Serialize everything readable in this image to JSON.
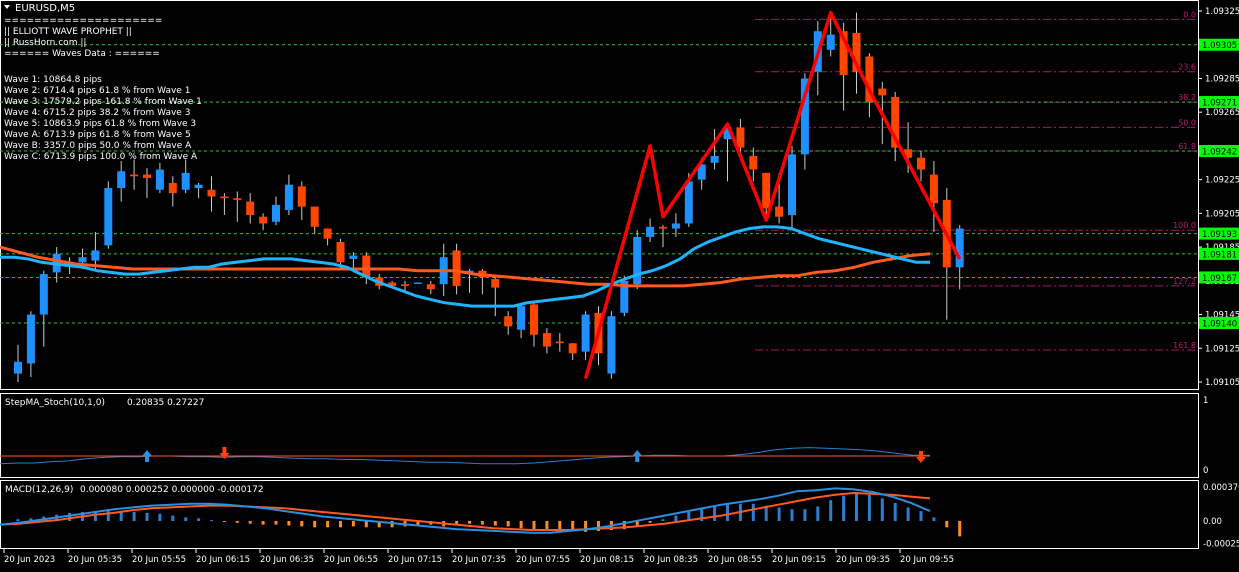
{
  "colors": {
    "background": "#000000",
    "frame": "#ffffff",
    "bull_candle": "#1e90ff",
    "bear_candle": "#ff4500",
    "wick": "#cccccc",
    "ma_fast": "#1fb4ff",
    "ma_slow": "#ff5a1f",
    "zigzag": "#ff0000",
    "green_level": "#3cbe3c",
    "green_tag_bg": "#00ff00",
    "fib_line": "#b01070",
    "fib_text": "#c01a7a",
    "text": "#ffffff"
  },
  "chart_header": {
    "symbol_label": "EURUSD,M5",
    "menu_icon": "triangle-down-icon"
  },
  "info_panel": {
    "lines": [
      "=====================",
      "||    ELLIOTT WAVE PROPHET   ||",
      "||          RussHorn.com          ||",
      "====== Waves Data : ======"
    ],
    "waves": [
      "Wave 1: 10864.8 pips",
      "Wave 2: 6714.4 pips 61.8 % from Wave 1",
      "Wave 3: 17579.2 pips 161.8 % from Wave 1",
      "Wave 4: 6715.2 pips 38.2 % from Wave 3",
      "Wave 5: 10863.9 pips 61.8 % from Wave 3",
      "Wave A: 6713.9 pips 61.8 % from Wave 5",
      "Wave B: 3357.0 pips 50.0 % from Wave A",
      "Wave C: 6713.9 pips 100.0 % from Wave A"
    ]
  },
  "chart_data": [
    {
      "type": "candlestick",
      "title": "EURUSD,M5",
      "ylim": [
        1.09095,
        1.09335
      ],
      "price_ticks": [
        "1.09325",
        "1.09285",
        "1.09265",
        "1.09225",
        "1.09205",
        "1.09185",
        "1.09165",
        "1.09145",
        "1.09125",
        "1.09105"
      ],
      "green_levels": [
        "1.09305",
        "1.09271",
        "1.09242",
        "1.09193",
        "1.09181",
        "1.09167",
        "1.09140"
      ],
      "fib_levels": [
        {
          "label": "0.0",
          "value": 1.0932
        },
        {
          "label": "23.6",
          "value": 1.09289
        },
        {
          "label": "38.2",
          "value": 1.09271
        },
        {
          "label": "50.0",
          "value": 1.09256
        },
        {
          "label": "61.8",
          "value": 1.09242
        },
        {
          "label": "100.0",
          "value": 1.09195
        },
        {
          "label": "127.2",
          "value": 1.09162
        },
        {
          "label": "161.8",
          "value": 1.09124
        }
      ],
      "candles": [
        [
          1.0911,
          1.09117,
          1.09105,
          1.09127
        ],
        [
          1.09116,
          1.09145,
          1.09108,
          1.09147
        ],
        [
          1.09145,
          1.09169,
          1.09126,
          1.09171
        ],
        [
          1.0917,
          1.09181,
          1.09164,
          1.09185
        ],
        [
          1.09176,
          1.09176,
          1.09169,
          1.09179
        ],
        [
          1.09176,
          1.09179,
          1.09172,
          1.09184
        ],
        [
          1.09177,
          1.09183,
          1.09172,
          1.09194
        ],
        [
          1.09186,
          1.0922,
          1.09184,
          1.09224
        ],
        [
          1.0922,
          1.0923,
          1.09212,
          1.09236
        ],
        [
          1.09228,
          1.09227,
          1.09219,
          1.09237
        ],
        [
          1.09228,
          1.09226,
          1.09214,
          1.09232
        ],
        [
          1.09219,
          1.09231,
          1.09217,
          1.09235
        ],
        [
          1.09223,
          1.09217,
          1.09209,
          1.09227
        ],
        [
          1.09219,
          1.09229,
          1.09217,
          1.09237
        ],
        [
          1.0922,
          1.09222,
          1.09214,
          1.09223
        ],
        [
          1.09219,
          1.09215,
          1.09206,
          1.09227
        ],
        [
          1.09215,
          1.09214,
          1.09204,
          1.09217
        ],
        [
          1.09214,
          1.09213,
          1.092,
          1.09218
        ],
        [
          1.09212,
          1.09204,
          1.09199,
          1.09217
        ],
        [
          1.09203,
          1.09199,
          1.09195,
          1.09205
        ],
        [
          1.092,
          1.0921,
          1.09198,
          1.09215
        ],
        [
          1.09207,
          1.09222,
          1.09204,
          1.09228
        ],
        [
          1.09221,
          1.09209,
          1.09201,
          1.09224
        ],
        [
          1.09209,
          1.09197,
          1.09193,
          1.09209
        ],
        [
          1.09196,
          1.0919,
          1.09186,
          1.09196
        ],
        [
          1.09188,
          1.09176,
          1.09172,
          1.0919
        ],
        [
          1.09178,
          1.0918,
          1.0917,
          1.09182
        ],
        [
          1.0918,
          1.09167,
          1.09163,
          1.09182
        ],
        [
          1.09167,
          1.09162,
          1.0916,
          1.09169
        ],
        [
          1.09164,
          1.09162,
          1.09162,
          1.09165
        ],
        [
          1.09163,
          1.09162,
          1.09159,
          1.09165
        ],
        [
          1.09164,
          1.09164,
          1.09164,
          1.09164
        ],
        [
          1.09163,
          1.0916,
          1.09157,
          1.09165
        ],
        [
          1.09163,
          1.09179,
          1.09156,
          1.09187
        ],
        [
          1.09183,
          1.09162,
          1.09157,
          1.09187
        ],
        [
          1.09169,
          1.09171,
          1.09158,
          1.09172
        ],
        [
          1.09171,
          1.09167,
          1.09157,
          1.09172
        ],
        [
          1.09166,
          1.09161,
          1.09144,
          1.09167
        ],
        [
          1.09144,
          1.09138,
          1.09133,
          1.09147
        ],
        [
          1.09136,
          1.0915,
          1.09131,
          1.09152
        ],
        [
          1.09151,
          1.09133,
          1.09126,
          1.09153
        ],
        [
          1.09134,
          1.09126,
          1.09122,
          1.09137
        ],
        [
          1.09129,
          1.09128,
          1.09123,
          1.09134
        ],
        [
          1.09128,
          1.09122,
          1.09118,
          1.09128
        ],
        [
          1.09123,
          1.09145,
          1.09118,
          1.09147
        ],
        [
          1.09146,
          1.09122,
          1.09115,
          1.0915
        ],
        [
          1.0911,
          1.09144,
          1.09107,
          1.09147
        ],
        [
          1.09146,
          1.09165,
          1.09144,
          1.09168
        ],
        [
          1.09163,
          1.09191,
          1.0916,
          1.09195
        ],
        [
          1.09191,
          1.09197,
          1.09188,
          1.09202
        ],
        [
          1.09197,
          1.09196,
          1.09185,
          1.09198
        ],
        [
          1.09196,
          1.09199,
          1.09191,
          1.09205
        ],
        [
          1.09199,
          1.09224,
          1.09197,
          1.09229
        ],
        [
          1.09225,
          1.09234,
          1.09219,
          1.09238
        ],
        [
          1.09235,
          1.09239,
          1.09231,
          1.09255
        ],
        [
          1.09249,
          1.09256,
          1.09224,
          1.09258
        ],
        [
          1.09256,
          1.09244,
          1.09237,
          1.09261
        ],
        [
          1.09239,
          1.09231,
          1.09224,
          1.09244
        ],
        [
          1.09229,
          1.09208,
          1.09201,
          1.09229
        ],
        [
          1.09209,
          1.09203,
          1.09199,
          1.09229
        ],
        [
          1.09204,
          1.0924,
          1.09196,
          1.09245
        ],
        [
          1.0924,
          1.09285,
          1.09231,
          1.09288
        ],
        [
          1.09289,
          1.09313,
          1.09275,
          1.09319
        ],
        [
          1.09302,
          1.09311,
          1.09298,
          1.09322
        ],
        [
          1.09313,
          1.09287,
          1.09266,
          1.09318
        ],
        [
          1.09312,
          1.09289,
          1.09276,
          1.09324
        ],
        [
          1.09298,
          1.09271,
          1.09262,
          1.093
        ],
        [
          1.09279,
          1.09275,
          1.09246,
          1.09283
        ],
        [
          1.09274,
          1.09244,
          1.09236,
          1.09277
        ],
        [
          1.09243,
          1.09238,
          1.09229,
          1.09259
        ],
        [
          1.09238,
          1.09231,
          1.09224,
          1.09242
        ],
        [
          1.09228,
          1.09211,
          1.09194,
          1.09236
        ],
        [
          1.09213,
          1.09173,
          1.09142,
          1.0922
        ],
        [
          1.09173,
          1.09196,
          1.0916,
          1.09198
        ]
      ],
      "ma_fast": [
        1.09179,
        1.09179,
        1.09178,
        1.09176,
        1.09175,
        1.09174,
        1.09173,
        1.09171,
        1.0917,
        1.09169,
        1.09169,
        1.0917,
        1.09171,
        1.09172,
        1.09173,
        1.09173,
        1.09175,
        1.09176,
        1.09177,
        1.09178,
        1.09178,
        1.09178,
        1.09177,
        1.09176,
        1.09175,
        1.09173,
        1.09169,
        1.09165,
        1.09162,
        1.09159,
        1.09156,
        1.09154,
        1.09152,
        1.09151,
        1.0915,
        1.0915,
        1.0915,
        1.0915,
        1.09152,
        1.09153,
        1.09154,
        1.09155,
        1.09156,
        1.09159,
        1.09163,
        1.09166,
        1.09169,
        1.09171,
        1.09174,
        1.09178,
        1.09184,
        1.09188,
        1.09191,
        1.09194,
        1.09196,
        1.09197,
        1.09197,
        1.09196,
        1.09193,
        1.0919,
        1.09188,
        1.09186,
        1.09184,
        1.09182,
        1.0918,
        1.09178,
        1.09176,
        1.09176
      ],
      "ma_slow": [
        1.09185,
        1.09182,
        1.09179,
        1.09177,
        1.09175,
        1.09174,
        1.09173,
        1.09172,
        1.09172,
        1.09172,
        1.09172,
        1.09172,
        1.09172,
        1.09172,
        1.09172,
        1.09172,
        1.09172,
        1.09172,
        1.09172,
        1.09172,
        1.09172,
        1.09172,
        1.09171,
        1.09171,
        1.09171,
        1.09169,
        1.09168,
        1.09167,
        1.09166,
        1.09165,
        1.09164,
        1.09163,
        1.09163,
        1.09162,
        1.09162,
        1.09162,
        1.09162,
        1.09163,
        1.09164,
        1.09166,
        1.09167,
        1.09168,
        1.09168,
        1.0917,
        1.09171,
        1.09173,
        1.09176,
        1.09178,
        1.0918,
        1.09181
      ],
      "zigzag": [
        [
          44,
          1.09107
        ],
        [
          49,
          1.09245
        ],
        [
          50,
          1.09203
        ],
        [
          55,
          1.09258
        ],
        [
          58,
          1.09201
        ],
        [
          63,
          1.09324
        ],
        [
          66,
          1.09278
        ],
        [
          73,
          1.09178
        ]
      ]
    },
    {
      "type": "line",
      "title": "StepMA_Stoch(10,1,0)",
      "legend_values": [
        "0.20835",
        "0.27227"
      ],
      "ylim": [
        0,
        1
      ],
      "y_ticks": [
        "1",
        "0"
      ],
      "series": [
        {
          "values": [
            0.09,
            0.1,
            0.1,
            0.12,
            0.13,
            0.16,
            0.18,
            0.19,
            0.19,
            0.2,
            0.2,
            0.19,
            0.19,
            0.18,
            0.19,
            0.19,
            0.18,
            0.17,
            0.16,
            0.16,
            0.15,
            0.15,
            0.14,
            0.13,
            0.12,
            0.11,
            0.11,
            0.1,
            0.09,
            0.09,
            0.09,
            0.1,
            0.12,
            0.14,
            0.16,
            0.18,
            0.19,
            0.2,
            0.21,
            0.21,
            0.2,
            0.2,
            0.2,
            0.22,
            0.25,
            0.29,
            0.31,
            0.32,
            0.31,
            0.3,
            0.29,
            0.27,
            0.24,
            0.21,
            0.21
          ]
        },
        {
          "values": [
            0.2,
            0.2,
            0.2,
            0.2,
            0.2,
            0.2
          ]
        }
      ],
      "up_arrows": [
        10,
        48
      ],
      "down_arrows": [
        16,
        70
      ]
    },
    {
      "type": "bar",
      "title": "MACD(12,26,9)",
      "legend_values": [
        "0.000080",
        "0.000252",
        "0.000000",
        "-0.000172"
      ],
      "ylim": [
        -0.00028,
        0.0004
      ],
      "y_ticks": [
        "0.000376",
        "0.00",
        "-0.00025"
      ],
      "histogram": [
        2e-05,
        3e-05,
        5e-05,
        7e-05,
        9e-05,
        0.0001,
        0.00011,
        0.00011,
        0.00011,
        0.0001,
        9e-05,
        8e-05,
        6e-05,
        4e-05,
        3e-05,
        1e-05,
        -1e-05,
        -2e-05,
        -3e-05,
        -4e-05,
        -4e-05,
        -5e-05,
        -6e-05,
        -7e-05,
        -7e-05,
        -7e-05,
        -6e-05,
        -7e-05,
        -7e-05,
        -7e-05,
        -6e-05,
        -5e-05,
        -4e-05,
        -6e-05,
        -4e-05,
        -3e-05,
        -4e-05,
        -5e-05,
        -6e-05,
        -8e-05,
        -9e-05,
        -0.0001,
        -0.0001,
        -0.00011,
        -0.00012,
        -0.00011,
        -0.0001,
        -9e-05,
        -6e-05,
        -2e-05,
        2e-05,
        6e-05,
        0.0001,
        0.00014,
        0.00016,
        0.00018,
        0.00019,
        0.00019,
        0.00017,
        0.00015,
        0.00013,
        0.00013,
        0.00016,
        0.00023,
        0.00028,
        0.0003,
        0.00029,
        0.00025,
        0.0002,
        0.00015,
        0.00011,
        4e-05,
        -7e-05,
        -0.00017
      ],
      "macd_line": [
        -4e-05,
        -2e-05,
        1e-05,
        4e-05,
        7e-05,
        0.0001,
        0.00013,
        0.00015,
        0.00017,
        0.00018,
        0.00019,
        0.00019,
        0.00018,
        0.00016,
        0.00014,
        0.00011,
        8e-05,
        5e-05,
        3e-05,
        1e-05,
        -1e-05,
        -3e-05,
        -5e-05,
        -7e-05,
        -9e-05,
        -0.0001,
        -0.00011,
        -0.00012,
        -0.00013,
        -0.00013,
        -0.00011,
        -9e-05,
        -6e-05,
        -2e-05,
        2e-05,
        6e-05,
        0.0001,
        0.00014,
        0.00018,
        0.00021,
        0.00024,
        0.00028,
        0.00033,
        0.00034,
        0.00036,
        0.00035,
        0.00032,
        0.00027,
        0.0002,
        0.00011
      ],
      "signal_line": [
        -4e-05,
        -3e-05,
        -1e-05,
        1e-05,
        4e-05,
        7e-05,
        9e-05,
        0.00012,
        0.00014,
        0.00015,
        0.00016,
        0.00017,
        0.00017,
        0.00016,
        0.00015,
        0.00014,
        0.00012,
        0.0001,
        8e-05,
        6e-05,
        4e-05,
        2e-05,
        0.0,
        -2e-05,
        -4e-05,
        -6e-05,
        -8e-05,
        -9e-05,
        -0.0001,
        -0.0001,
        -0.0001,
        -9e-05,
        -8e-05,
        -7e-05,
        -5e-05,
        -3e-05,
        0.0,
        3e-05,
        6e-05,
        0.0001,
        0.00014,
        0.00018,
        0.00022,
        0.00026,
        0.00029,
        0.00031,
        0.0003,
        0.00029,
        0.00027,
        0.00025
      ]
    }
  ],
  "time_axis": [
    "20 Jun 2023",
    "20 Jun 05:35",
    "20 Jun 05:55",
    "20 Jun 06:15",
    "20 Jun 06:35",
    "20 Jun 06:55",
    "20 Jun 07:15",
    "20 Jun 07:35",
    "20 Jun 07:55",
    "20 Jun 08:15",
    "20 Jun 08:35",
    "20 Jun 08:55",
    "20 Jun 09:15",
    "20 Jun 09:35",
    "20 Jun 09:55"
  ]
}
